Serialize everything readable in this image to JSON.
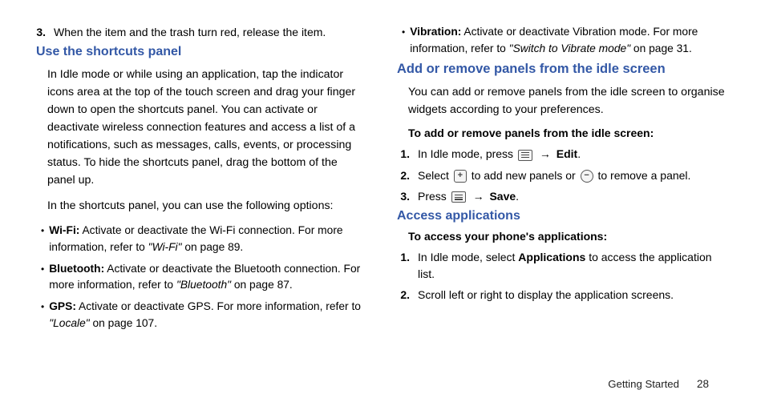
{
  "left": {
    "step3_num": "3.",
    "step3_text": "When the item and the trash turn red, release the item.",
    "heading1": "Use the shortcuts panel",
    "para1": "In Idle mode or while using an application, tap the indicator icons area at the top of the touch screen and drag your finger down to open the shortcuts panel. You can activate or deactivate wireless connection features and access a list of a notifications, such as messages, calls, events, or processing status. To hide the shortcuts panel, drag the bottom of the panel up.",
    "para2": "In the shortcuts panel, you can use the following options:",
    "bullets": [
      {
        "bold": "Wi-Fi:",
        "rest": " Activate or deactivate the Wi-Fi connection. For more information, refer to ",
        "italic": "\"Wi-Fi\"",
        "tail": "  on page 89."
      },
      {
        "bold": "Bluetooth:",
        "rest": " Activate or deactivate the Bluetooth connection. For more information, refer to ",
        "italic": "\"Bluetooth\"",
        "tail": "  on page 87."
      },
      {
        "bold": "GPS:",
        "rest": " Activate or deactivate GPS. For more information, refer to ",
        "italic": "\"Locale\"",
        "tail": "  on page 107."
      }
    ]
  },
  "right": {
    "vibration_bold": "Vibration:",
    "vibration_rest": " Activate or deactivate Vibration mode. For more information, refer to ",
    "vibration_italic": "\"Switch to Vibrate mode\"",
    "vibration_tail": "  on page 31.",
    "heading2": "Add or remove panels from the idle screen",
    "para3": "You can add or remove panels from the idle screen to organise widgets according to your preferences.",
    "sub1": "To add or remove panels from the idle screen:",
    "step1_num": "1.",
    "step1_pre": "In Idle mode, press ",
    "arrow": " → ",
    "edit_bold": "Edit",
    "period": ".",
    "step2_num": "2.",
    "step2_pre": "Select ",
    "step2_mid": " to add new panels or ",
    "step2_post": " to remove a panel.",
    "step3b_num": "3.",
    "step3b_pre": "Press ",
    "save_bold": "Save",
    "heading3": "Access applications",
    "sub2": "To access your phone's applications:",
    "access1_num": "1.",
    "access1_pre": "In Idle mode, select ",
    "access1_bold": "Applications",
    "access1_post": " to access the application list.",
    "access2_num": "2.",
    "access2_text": "Scroll left or right to display the application screens."
  },
  "footer": {
    "section": "Getting Started",
    "page": "28"
  }
}
